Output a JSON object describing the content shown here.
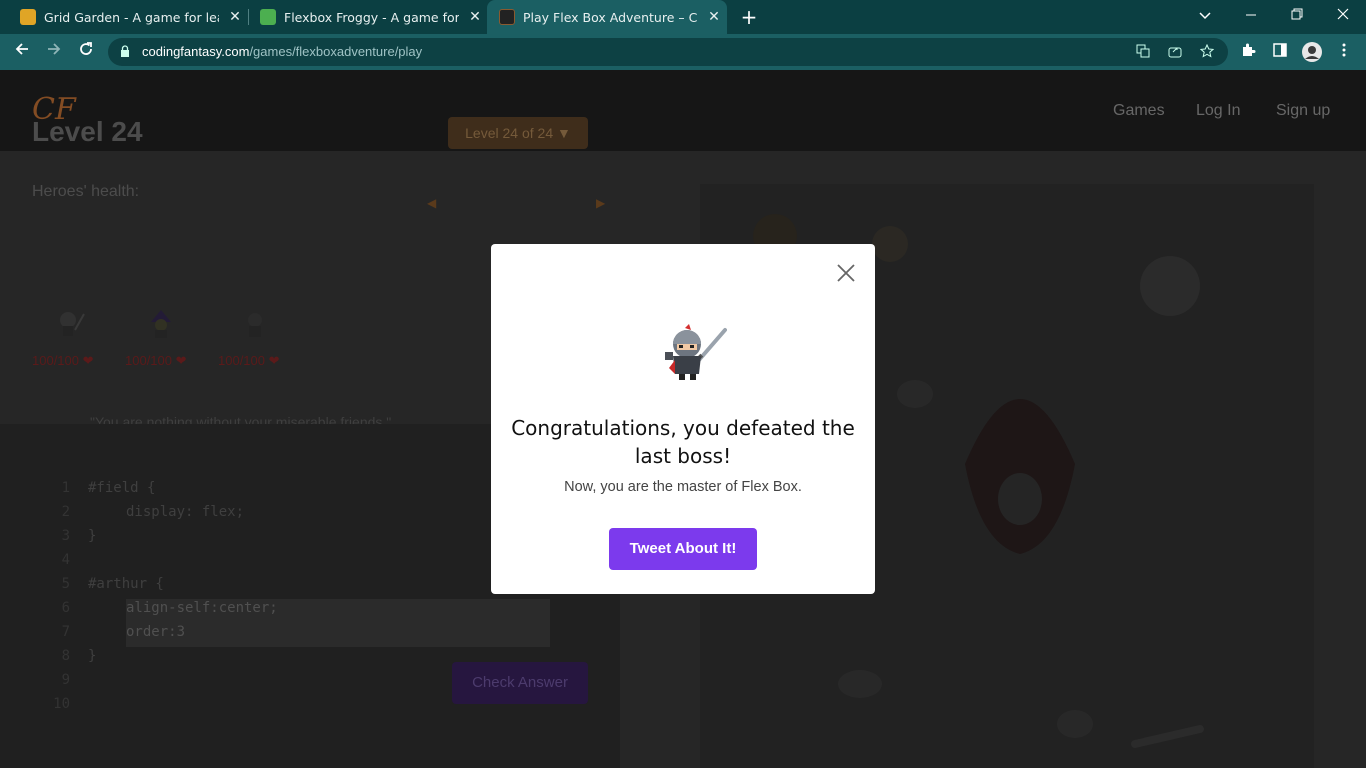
{
  "browser": {
    "tabs": [
      {
        "title": "Grid Garden - A game for learning CSS grid",
        "close": "✕"
      },
      {
        "title": "Flexbox Froggy - A game for learning CSS flexbox",
        "close": "✕"
      },
      {
        "title": "Play Flex Box Adventure – CSS Game to Learn Flexbox",
        "close": "✕"
      }
    ],
    "new_tab": "+",
    "url_domain": "codingfantasy.com",
    "url_path": "/games/flexboxadventure/play"
  },
  "site": {
    "logo": "CF",
    "nav": [
      "Games",
      "Log In",
      "Sign up"
    ]
  },
  "game": {
    "level_title": "Level 24",
    "level_select": "Level 24 of 24 ▼",
    "health_label": "Heroes' health:",
    "heroes": [
      {
        "hp": "100/100 ❤"
      },
      {
        "hp": "100/100 ❤"
      },
      {
        "hp": "100/100 ❤"
      }
    ],
    "quote": "\"You are nothing without your miserable friends.\"",
    "check_button": "Check Answer"
  },
  "editor": {
    "lines": [
      {
        "n": "1",
        "text": "#field {"
      },
      {
        "n": "2",
        "text": "display: flex;"
      },
      {
        "n": "3",
        "text": "}"
      },
      {
        "n": "4",
        "text": ""
      },
      {
        "n": "5",
        "text": "#arthur {"
      },
      {
        "n": "6",
        "text": "align-self:center;"
      },
      {
        "n": "7",
        "text": "order:3"
      },
      {
        "n": "8",
        "text": "}"
      },
      {
        "n": "9",
        "text": ""
      },
      {
        "n": "10",
        "text": ""
      }
    ]
  },
  "modal": {
    "title": "Congratulations, you defeated the last boss!",
    "subtitle": "Now, you are the master of Flex Box.",
    "button": "Tweet About It!"
  },
  "colors": {
    "accent": "#7c3aed",
    "chrome": "#1b5f63"
  }
}
